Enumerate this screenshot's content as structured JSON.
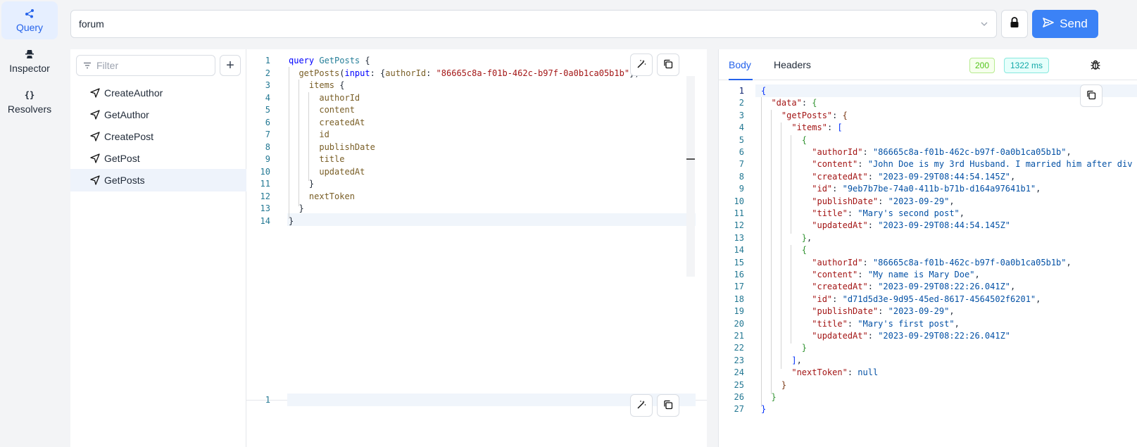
{
  "rail": [
    {
      "label": "Query",
      "icon": "share-nodes-icon",
      "active": true
    },
    {
      "label": "Inspector",
      "icon": "detective-icon",
      "active": false
    },
    {
      "label": "Resolvers",
      "icon": "braces-icon",
      "active": false
    }
  ],
  "endpoint": {
    "value": "forum"
  },
  "send": {
    "label": "Send"
  },
  "operations": {
    "filter_placeholder": "Filter",
    "items": [
      "CreateAuthor",
      "GetAuthor",
      "CreatePost",
      "GetPost",
      "GetPosts"
    ],
    "selected": "GetPosts"
  },
  "query_lines": [
    {
      "n": "1",
      "html": "<span class=\"kw\">query</span> <span class=\"tn\">GetPosts</span> {"
    },
    {
      "n": "2",
      "html": "  <span class=\"fld\">getPosts</span>(<span class=\"kw\">input</span>: {<span class=\"arg\">authorId</span>: <span class=\"str\">\"86665c8a-f01b-462c-b97f-0a0b1ca05b1b\"</span>})"
    },
    {
      "n": "3",
      "html": "    <span class=\"fld\">items</span> {"
    },
    {
      "n": "4",
      "html": "      <span class=\"fld\">authorId</span>"
    },
    {
      "n": "5",
      "html": "      <span class=\"fld\">content</span>"
    },
    {
      "n": "6",
      "html": "      <span class=\"fld\">createdAt</span>"
    },
    {
      "n": "7",
      "html": "      <span class=\"fld\">id</span>"
    },
    {
      "n": "8",
      "html": "      <span class=\"fld\">publishDate</span>"
    },
    {
      "n": "9",
      "html": "      <span class=\"fld\">title</span>"
    },
    {
      "n": "10",
      "html": "      <span class=\"fld\">updatedAt</span>"
    },
    {
      "n": "11",
      "html": "    }"
    },
    {
      "n": "12",
      "html": "    <span class=\"fld\">nextToken</span>"
    },
    {
      "n": "13",
      "html": "  }"
    },
    {
      "n": "14",
      "html": "}"
    }
  ],
  "variables_lines": [
    {
      "n": "1",
      "text": ""
    }
  ],
  "result": {
    "tabs": [
      "Body",
      "Headers"
    ],
    "active_tab": "Body",
    "status": "200",
    "time": "1322 ms",
    "lines": [
      {
        "n": "1",
        "html": "<span class=\"p1\">{</span>"
      },
      {
        "n": "2",
        "html": "  <span class=\"k\">\"data\"</span>: <span class=\"p2\">{</span>"
      },
      {
        "n": "3",
        "html": "    <span class=\"k\">\"getPosts\"</span>: <span class=\"p3\">{</span>"
      },
      {
        "n": "4",
        "html": "      <span class=\"k\">\"items\"</span>: <span class=\"p1\">[</span>"
      },
      {
        "n": "5",
        "html": "        <span class=\"p2\">{</span>"
      },
      {
        "n": "6",
        "html": "          <span class=\"k\">\"authorId\"</span>: <span class=\"s\">\"86665c8a-f01b-462c-b97f-0a0b1ca05b1b\"</span>,"
      },
      {
        "n": "7",
        "html": "          <span class=\"k\">\"content\"</span>: <span class=\"s\">\"John Doe is my 3rd Husband. I married him after div</span>"
      },
      {
        "n": "8",
        "html": "          <span class=\"k\">\"createdAt\"</span>: <span class=\"s\">\"2023-09-29T08:44:54.145Z\"</span>,"
      },
      {
        "n": "9",
        "html": "          <span class=\"k\">\"id\"</span>: <span class=\"s\">\"9eb7b7be-74a0-411b-b71b-d164a97641b1\"</span>,"
      },
      {
        "n": "10",
        "html": "          <span class=\"k\">\"publishDate\"</span>: <span class=\"s\">\"2023-09-29\"</span>,"
      },
      {
        "n": "11",
        "html": "          <span class=\"k\">\"title\"</span>: <span class=\"s\">\"Mary's second post\"</span>,"
      },
      {
        "n": "12",
        "html": "          <span class=\"k\">\"updatedAt\"</span>: <span class=\"s\">\"2023-09-29T08:44:54.145Z\"</span>"
      },
      {
        "n": "13",
        "html": "        <span class=\"p2\">}</span>,"
      },
      {
        "n": "14",
        "html": "        <span class=\"p2\">{</span>"
      },
      {
        "n": "15",
        "html": "          <span class=\"k\">\"authorId\"</span>: <span class=\"s\">\"86665c8a-f01b-462c-b97f-0a0b1ca05b1b\"</span>,"
      },
      {
        "n": "16",
        "html": "          <span class=\"k\">\"content\"</span>: <span class=\"s\">\"My name is Mary Doe\"</span>,"
      },
      {
        "n": "17",
        "html": "          <span class=\"k\">\"createdAt\"</span>: <span class=\"s\">\"2023-09-29T08:22:26.041Z\"</span>,"
      },
      {
        "n": "18",
        "html": "          <span class=\"k\">\"id\"</span>: <span class=\"s\">\"d71d5d3e-9d95-45ed-8617-4564502f6201\"</span>,"
      },
      {
        "n": "19",
        "html": "          <span class=\"k\">\"publishDate\"</span>: <span class=\"s\">\"2023-09-29\"</span>,"
      },
      {
        "n": "20",
        "html": "          <span class=\"k\">\"title\"</span>: <span class=\"s\">\"Mary's first post\"</span>,"
      },
      {
        "n": "21",
        "html": "          <span class=\"k\">\"updatedAt\"</span>: <span class=\"s\">\"2023-09-29T08:22:26.041Z\"</span>"
      },
      {
        "n": "22",
        "html": "        <span class=\"p2\">}</span>"
      },
      {
        "n": "23",
        "html": "      <span class=\"p1\">]</span>,"
      },
      {
        "n": "24",
        "html": "      <span class=\"k\">\"nextToken\"</span>: <span class=\"nl\">null</span>"
      },
      {
        "n": "25",
        "html": "    <span class=\"p3\">}</span>"
      },
      {
        "n": "26",
        "html": "  <span class=\"p2\">}</span>"
      },
      {
        "n": "27",
        "html": "<span class=\"p1\">}</span>"
      }
    ]
  },
  "colors": {
    "accent": "#3b82f6",
    "status_ok": "#52c41a",
    "time_badge": "#13a8a8"
  }
}
